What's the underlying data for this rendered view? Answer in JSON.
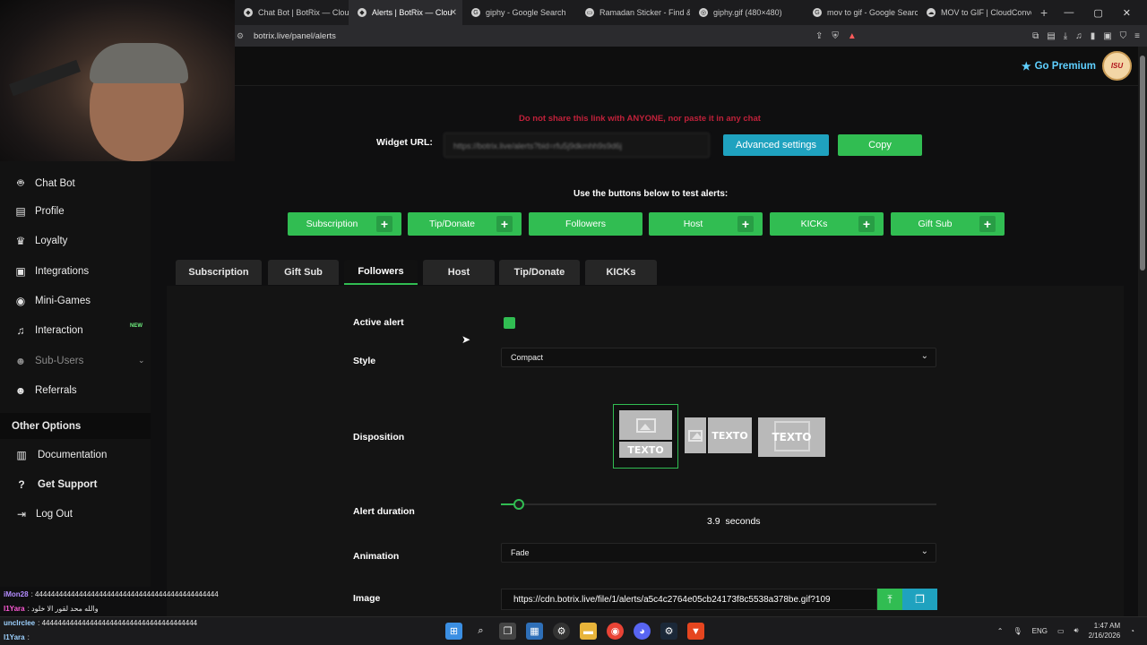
{
  "browser": {
    "tabs": [
      {
        "title": "Chat Bot | BotRix — Cloud",
        "active": false
      },
      {
        "title": "Alerts | BotRix — Clou",
        "active": true
      },
      {
        "title": "giphy - Google Search",
        "active": false
      },
      {
        "title": "Ramadan Sticker - Find &",
        "active": false
      },
      {
        "title": "giphy.gif (480×480)",
        "active": false
      },
      {
        "title": "mov to gif - Google Searc",
        "active": false
      },
      {
        "title": "MOV to GIF | CloudConve",
        "active": false
      }
    ],
    "url": "botrix.live/panel/alerts"
  },
  "header": {
    "premium_label": "Go Premium",
    "avatar_text": "ISU"
  },
  "sidebar": {
    "items": [
      {
        "label": "Chat Bot",
        "icon": "robot-icon"
      },
      {
        "label": "Profile",
        "icon": "id-card-icon"
      },
      {
        "label": "Loyalty",
        "icon": "trophy-icon"
      },
      {
        "label": "Integrations",
        "icon": "puzzle-icon"
      },
      {
        "label": "Mini-Games",
        "icon": "gamepad-icon"
      },
      {
        "label": "Interaction",
        "icon": "music-icon"
      },
      {
        "label": "Sub-Users",
        "icon": "users-icon"
      },
      {
        "label": "Referrals",
        "icon": "user-group-icon"
      }
    ],
    "new_badge": "NEW",
    "other_options_label": "Other Options",
    "other_items": [
      {
        "label": "Documentation",
        "icon": "book-icon"
      },
      {
        "label": "Get Support",
        "icon": "question-icon"
      },
      {
        "label": "Log Out",
        "icon": "logout-icon"
      }
    ]
  },
  "widget": {
    "warning": "Do not share this link with ANYONE, nor paste it in any chat",
    "label": "Widget URL:",
    "url_value": "https://botrix.live/alerts?bid=rfu5j9dkmhh9s9d6j",
    "advanced_label": "Advanced settings",
    "copy_label": "Copy"
  },
  "test": {
    "hint": "Use the buttons below to test alerts:",
    "buttons": [
      {
        "label": "Subscription",
        "plus": true
      },
      {
        "label": "Tip/Donate",
        "plus": true
      },
      {
        "label": "Followers",
        "plus": false
      },
      {
        "label": "Host",
        "plus": true
      },
      {
        "label": "KICKs",
        "plus": true
      },
      {
        "label": "Gift Sub",
        "plus": true
      }
    ]
  },
  "alert_tabs": [
    {
      "label": "Subscription",
      "active": false
    },
    {
      "label": "Gift Sub",
      "active": false
    },
    {
      "label": "Followers",
      "active": true
    },
    {
      "label": "Host",
      "active": false
    },
    {
      "label": "Tip/Donate",
      "active": false
    },
    {
      "label": "KICKs",
      "active": false
    }
  ],
  "form": {
    "active_alert_label": "Active alert",
    "active_alert_checked": true,
    "style_label": "Style",
    "style_value": "Compact",
    "disposition_label": "Disposition",
    "disposition_text": "TEXTO",
    "disposition_selected": 0,
    "duration_label": "Alert duration",
    "duration_value": "3.9",
    "duration_unit": "seconds",
    "duration_fraction": 0.02,
    "animation_label": "Animation",
    "animation_value": "Fade",
    "image_label": "Image",
    "image_url": "https://cdn.botrix.live/file/1/alerts/a5c4c2764e05cb24173f8c5538a378be.gif?109"
  },
  "chat_overlay": [
    {
      "name": "iMon28",
      "msg": ": 4444444444444444444444444444444444444444444444"
    },
    {
      "name": "I1Yara",
      "msg": ": والله محد لقور الا خلود"
    },
    {
      "name": "unclrclee",
      "msg": ": 444444444444444444444444444444444444444"
    },
    {
      "name": "I1Yara",
      "msg": ":"
    }
  ],
  "taskbar": {
    "lang": "ENG",
    "time": "1:47 AM",
    "date": "2/16/2026"
  },
  "colors": {
    "accent_green": "#31bd52",
    "accent_cyan": "#1fa2bf",
    "warning_red": "#c0213a",
    "premium_blue": "#5fd0ff"
  }
}
